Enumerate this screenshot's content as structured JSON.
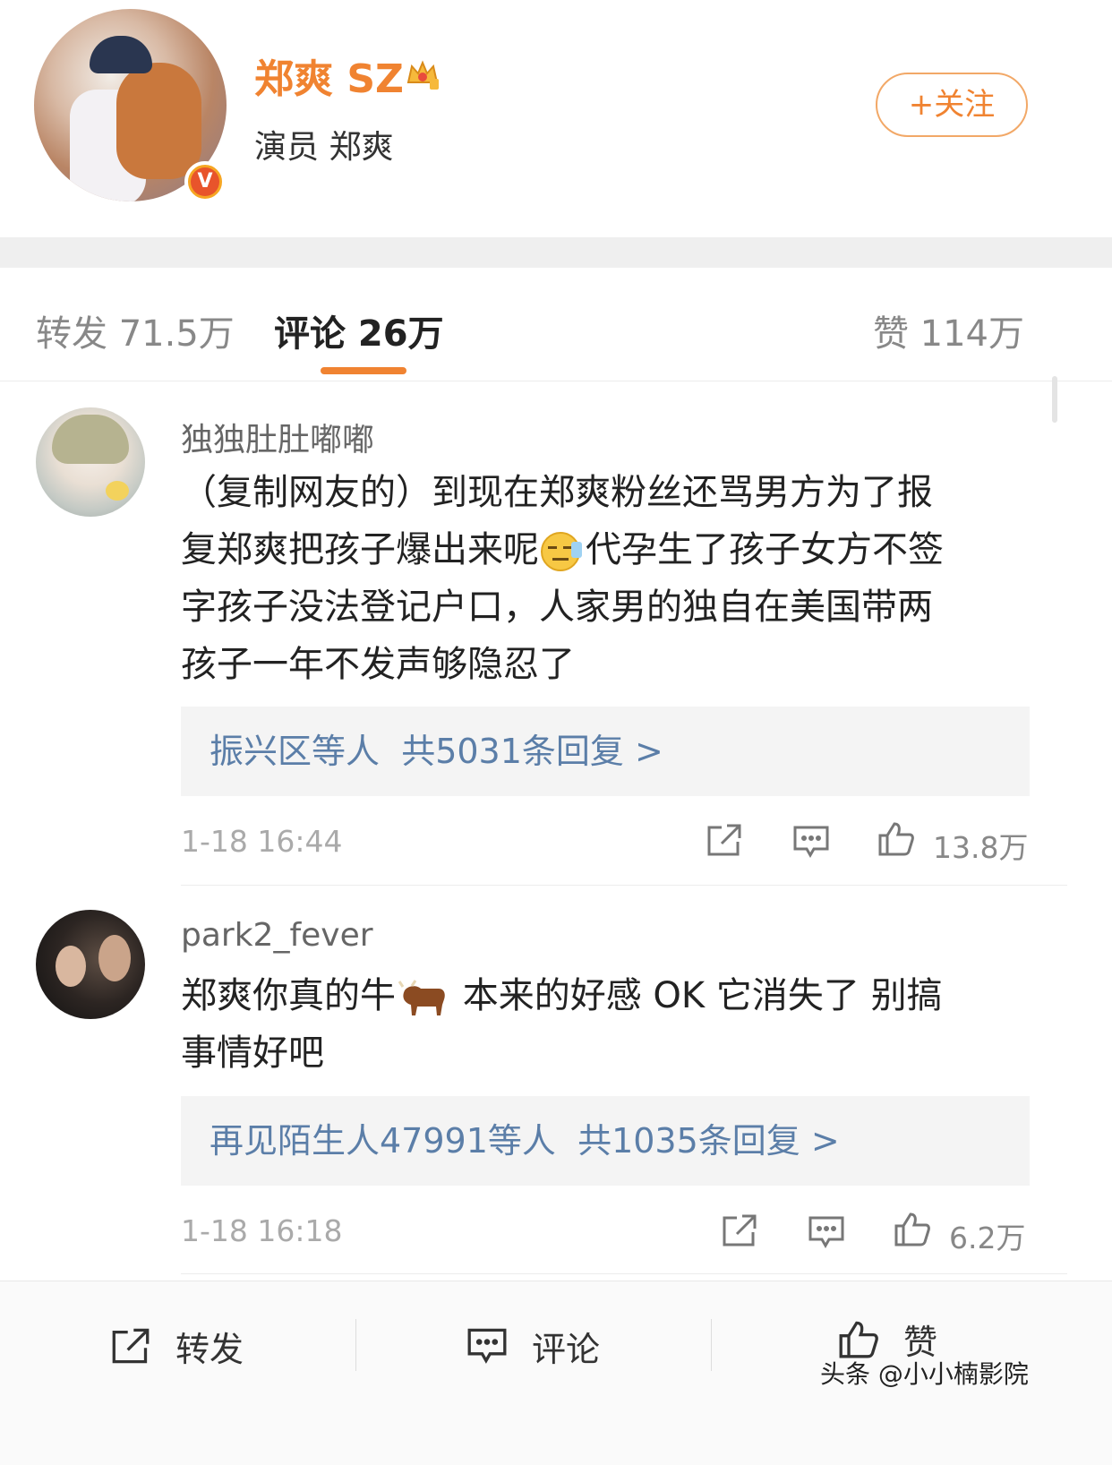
{
  "profile": {
    "name": "郑爽 SZ",
    "subtitle": "演员 郑爽",
    "follow_label": "+关注",
    "verified_badge": "V"
  },
  "tabs": {
    "repost": "转发 71.5万",
    "comment": "评论 26万",
    "like": "赞 114万"
  },
  "comments": [
    {
      "username": "独独肚肚嘟嘟",
      "text_line1": "（复制网友的）到现在郑爽粉丝还骂男方为了报",
      "text_line2_a": "复郑爽把孩子爆出来呢",
      "text_line2_b": "代孕生了孩子女方不签",
      "text_line3": "字孩子没法登记户口，人家男的独自在美国带两",
      "text_line4": "孩子一年不发声够隐忍了",
      "reply_prefix": "振兴区等人",
      "reply_link": "共5031条回复 >",
      "time": "1-18 16:44",
      "likes": "13.8万"
    },
    {
      "username": "park2_fever",
      "text_line1_a": "郑爽你真的牛",
      "text_line1_b": "本来的好感 OK 它消失了 别搞",
      "text_line2": "事情好吧",
      "reply_prefix": "再见陌生人47991等人",
      "reply_link": "共1035条回复 >",
      "time": "1-18 16:18",
      "likes": "6.2万"
    }
  ],
  "bottom_bar": {
    "repost": "转发",
    "comment": "评论",
    "like": "赞"
  },
  "watermark": "头条 @小小楠影院",
  "colors": {
    "accent": "#f08331",
    "link": "#5b7ea8",
    "muted": "#888888"
  },
  "icons": [
    "share-icon",
    "comment-icon",
    "thumbs-up-icon",
    "crown-icon",
    "verified-v-icon",
    "expressionless-emoji-icon",
    "ox-emoji-icon"
  ]
}
